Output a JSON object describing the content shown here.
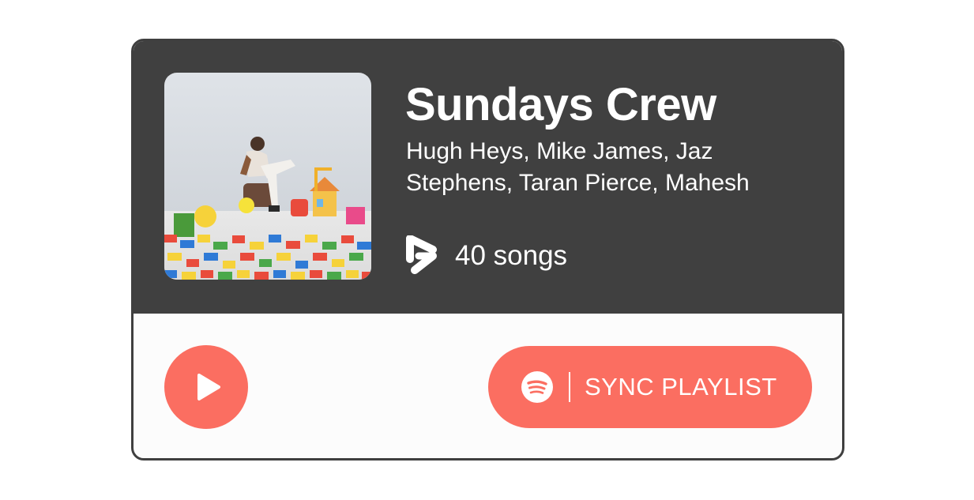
{
  "playlist": {
    "title": "Sundays Crew",
    "artists": "Hugh Heys, Mike James, Jaz Stephens, Taran Pierce, Mahesh",
    "song_count": "40 songs",
    "cover_alt": "Playlist cover art"
  },
  "actions": {
    "play_label": "Play",
    "sync_label": "SYNC PLAYLIST"
  },
  "icons": {
    "songs": "playlist-logo-icon",
    "play": "play-icon",
    "sync": "spotify-icon"
  },
  "colors": {
    "header_bg": "#404040",
    "card_bg": "#fcfcfc",
    "accent": "#fb6e61",
    "border": "#3f3f3f",
    "text_light": "#ffffff"
  }
}
